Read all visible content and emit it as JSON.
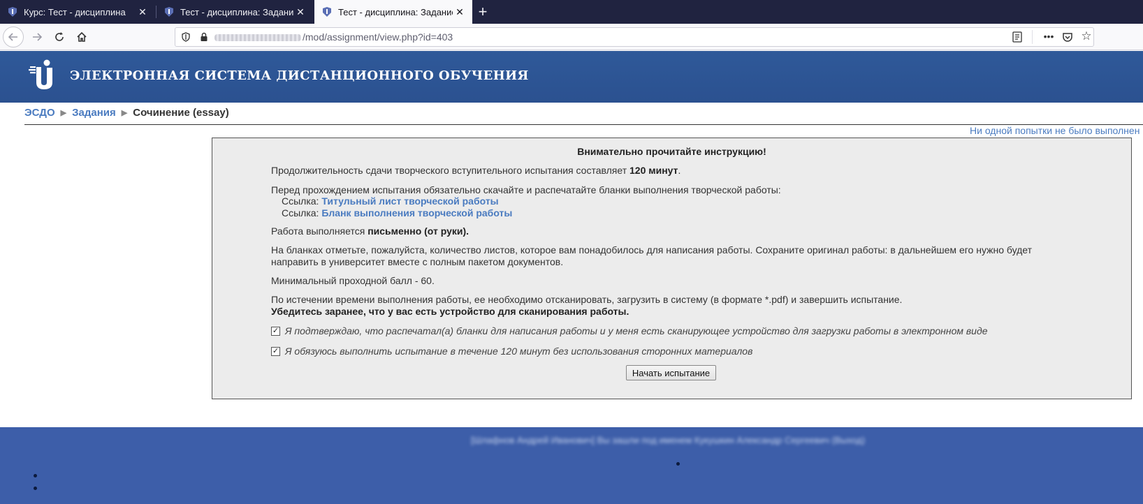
{
  "browser": {
    "tabs": [
      {
        "title": "Курс: Тест - дисциплина",
        "active": false
      },
      {
        "title": "Тест - дисциплина: Задания",
        "active": false
      },
      {
        "title": "Тест - дисциплина: Задание: С",
        "active": true
      }
    ],
    "close_glyph": "✕",
    "new_tab_glyph": "+",
    "url": {
      "path": "/mod/assignment/view.php?id=403"
    },
    "more_glyph": "•••",
    "star_glyph": "☆"
  },
  "site": {
    "title": "ЭЛЕКТРОННАЯ СИСТЕМА ДИСТАНЦИОННОГО ОБУЧЕНИЯ",
    "brand_color": "#2c5392"
  },
  "breadcrumb": {
    "items": [
      {
        "label": "ЭСДО"
      },
      {
        "label": "Задания"
      }
    ],
    "current": "Сочинение (essay)",
    "separator": "▶"
  },
  "attempt_status": "Ни одной попытки не было выполнен",
  "instructions": {
    "heading": "Внимательно прочитайте инструкцию!",
    "duration_prefix": "Продолжительность сдачи творческого вступительного испытания составляет ",
    "duration_value": "120 минут",
    "duration_suffix": ".",
    "forms_intro": "Перед прохождением испытания обязательно скачайте и распечатайте бланки выполнения творческой работы:",
    "links": [
      {
        "prefix": "Ссылка: ",
        "label": "Титульный лист творческой работы"
      },
      {
        "prefix": "Ссылка: ",
        "label": "Бланк выполнения творческой работы"
      }
    ],
    "handwritten_prefix": "Работа выполняется ",
    "handwritten_value": "письменно (от руки).",
    "sheets_line1": "На бланках отметьте, пожалуйста, количество листов, которое вам понадобилось для написания работы. Сохраните оригинал работы: в дальнейшем его нужно будет",
    "sheets_line2": "направить в университет вместе с полным пакетом документов.",
    "min_score": "Минимальный проходной балл - 60.",
    "scan_line": "По истечении времени выполнения работы, ее необходимо отсканировать, загрузить в систему (в формате *.pdf) и завершить испытание.",
    "scan_warning": "Убедитесь заранее, что у вас есть устройство для сканирования работы.",
    "checkboxes": [
      {
        "label": "Я подтверждаю, что распечатал(а) бланки для написания работы и у меня есть сканирующее устройство для загрузки работы в электронном виде",
        "checked": true,
        "mark": "✓"
      },
      {
        "label": "Я обязуюсь выполнить испытание в течение 120 минут без использования сторонних материалов",
        "checked": true,
        "mark": "✓"
      }
    ],
    "start_button": "Начать испытание"
  },
  "footer": {
    "login_info": "[Шлафнов Андрей Иванович] Вы зашли под именем Кукушкин Александр Сергеевич (Выход)"
  }
}
